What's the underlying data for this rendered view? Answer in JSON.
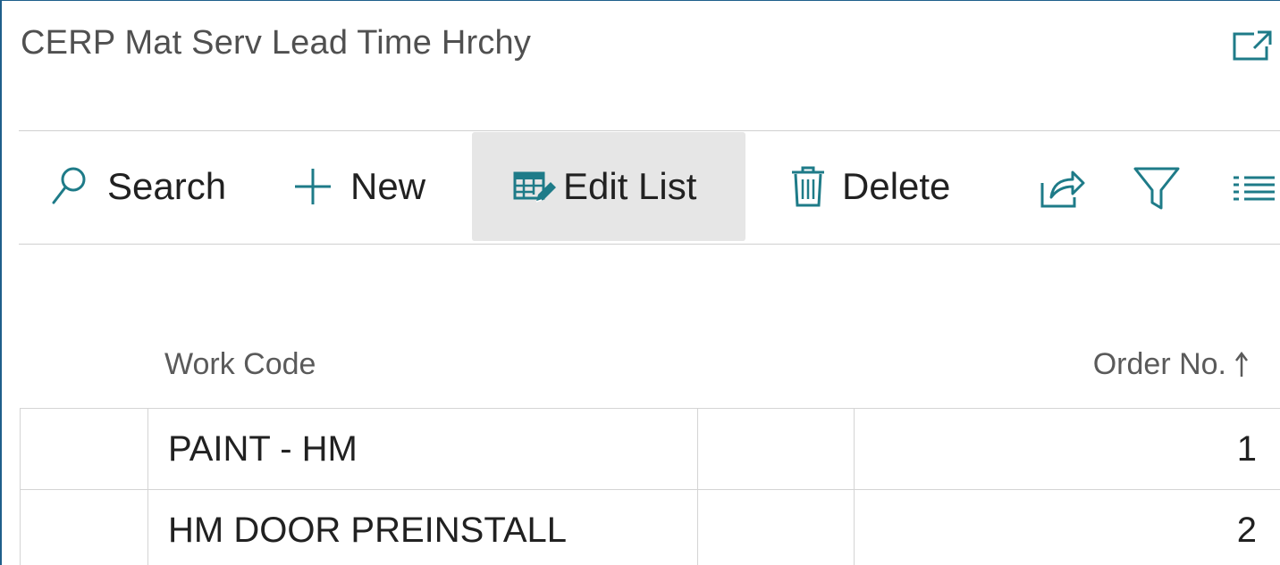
{
  "page": {
    "title": "CERP Mat Serv Lead Time Hrchy",
    "expand_icon": "open-in-new-window-icon"
  },
  "toolbar": {
    "search_label": "Search",
    "new_label": "New",
    "edit_list_label": "Edit List",
    "delete_label": "Delete",
    "icons": {
      "search": "magnifier-icon",
      "new": "plus-icon",
      "edit_list": "edit-table-icon",
      "delete": "trash-icon",
      "share": "share-icon",
      "filter": "filter-icon",
      "layout": "list-layout-icon"
    },
    "active_item": "Edit List"
  },
  "list": {
    "columns": {
      "work_code": "Work Code",
      "order_no": "Order No.",
      "sort_indicator": "ascending-arrow"
    },
    "rows": [
      {
        "work_code": "PAINT - HM",
        "order_no": "1"
      },
      {
        "work_code": "HM DOOR PREINSTALL",
        "order_no": "2"
      }
    ]
  },
  "colors": {
    "accent": "#1e7b88",
    "frame_border": "#1f5f8b",
    "active_bg": "#e6e6e6",
    "text": "#212121",
    "muted_text": "#5a5a5a"
  }
}
